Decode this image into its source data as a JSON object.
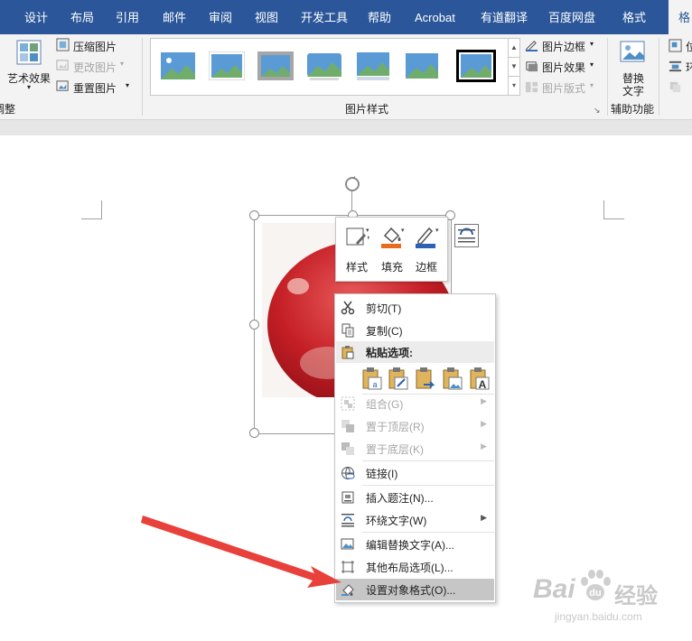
{
  "ribbon": {
    "tabs": [
      "设计",
      "布局",
      "引用",
      "邮件",
      "审阅",
      "视图",
      "开发工具",
      "帮助",
      "Acrobat",
      "有道翻译",
      "百度网盘",
      "格式",
      "格"
    ],
    "active_tab": "格式",
    "adjust": {
      "art_effect": "艺术效果",
      "compress": "压缩图片",
      "change": "更改图片",
      "reset": "重置图片",
      "group_label": "调整"
    },
    "styles": {
      "border": "图片边框",
      "effect": "图片效果",
      "layout": "图片版式",
      "group_label": "图片样式"
    },
    "accessibility": {
      "alt_text_l1": "替换",
      "alt_text_l2": "文字",
      "group_label": "辅助功能"
    },
    "arrange": {
      "pos": "位",
      "wrap": "环"
    }
  },
  "mini_toolbar": {
    "style": "样式",
    "fill": "填充",
    "border": "边框"
  },
  "context_menu": {
    "cut": "剪切(T)",
    "copy": "复制(C)",
    "paste_options": "粘贴选项:",
    "group": "组合(G)",
    "bring_front": "置于顶层(R)",
    "send_back": "置于底层(K)",
    "link": "链接(I)",
    "insert_caption": "插入题注(N)...",
    "wrap_text": "环绕文字(W)",
    "edit_alt_text": "编辑替换文字(A)...",
    "more_layout": "其他布局选项(L)...",
    "format_object": "设置对象格式(O)..."
  },
  "watermark": {
    "brand": "Bai",
    "brand2": "经验",
    "url": "jingyan.baidu.com"
  },
  "colors": {
    "ribbon_tab": "#2b579a",
    "arrow": "#e8403a",
    "fill_accent": "#e86b1e",
    "border_accent": "#2b62b5"
  },
  "icons": {
    "cut": "scissors-icon",
    "copy": "copy-icon",
    "paste": "clipboard-icon",
    "link": "link-icon",
    "rotate": "rotate-icon",
    "layout_options": "layout-options-icon"
  }
}
